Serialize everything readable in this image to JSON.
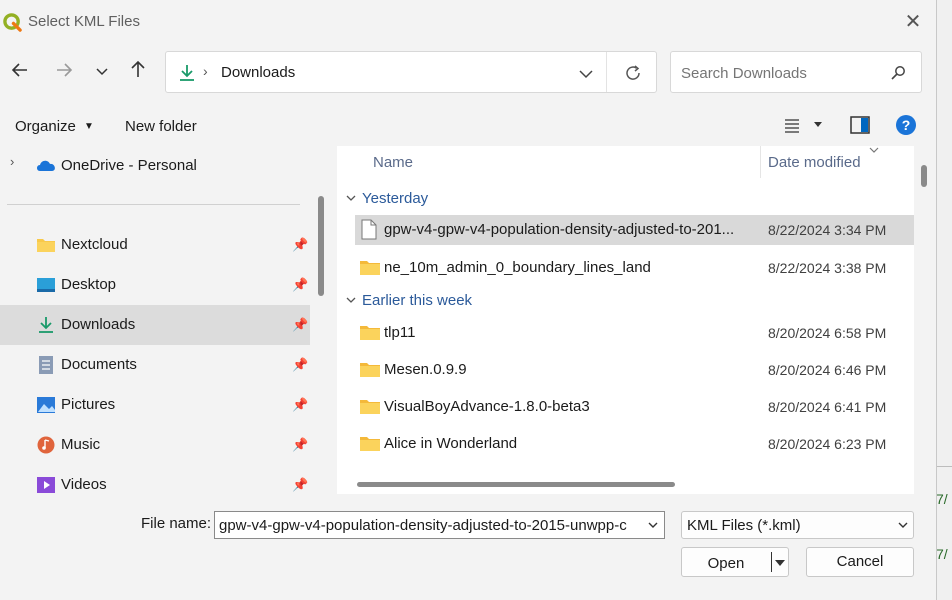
{
  "window": {
    "title": "Select KML Files",
    "close_icon": "close-icon"
  },
  "nav_buttons": {
    "back": "back-icon",
    "forward": "forward-icon",
    "recent": "chevron-down-icon",
    "up": "up-arrow-icon"
  },
  "address": {
    "location": "Downloads",
    "icon": "downloads-icon"
  },
  "search": {
    "placeholder": "Search Downloads"
  },
  "toolbar": {
    "organize_label": "Organize",
    "new_folder_label": "New folder"
  },
  "nav_pane": {
    "onedrive": "OneDrive - Personal",
    "items": [
      {
        "label": "Nextcloud"
      },
      {
        "label": "Desktop"
      },
      {
        "label": "Downloads",
        "selected": true
      },
      {
        "label": "Documents"
      },
      {
        "label": "Pictures"
      },
      {
        "label": "Music"
      },
      {
        "label": "Videos"
      }
    ]
  },
  "file_list": {
    "columns": {
      "name": "Name",
      "date": "Date modified"
    },
    "groups": [
      {
        "label": "Yesterday"
      },
      {
        "label": "Earlier this week"
      }
    ],
    "rows": [
      {
        "name": "gpw-v4-gpw-v4-population-density-adjusted-to-201...",
        "date": "8/22/2024 3:34 PM",
        "type": "file"
      },
      {
        "name": "ne_10m_admin_0_boundary_lines_land",
        "date": "8/22/2024 3:38 PM",
        "type": "folder"
      },
      {
        "name": "tlp11",
        "date": "8/20/2024 6:58 PM",
        "type": "folder"
      },
      {
        "name": "Mesen.0.9.9",
        "date": "8/20/2024 6:46 PM",
        "type": "folder"
      },
      {
        "name": "VisualBoyAdvance-1.8.0-beta3",
        "date": "8/20/2024 6:41 PM",
        "type": "folder"
      },
      {
        "name": "Alice in Wonderland",
        "date": "8/20/2024 6:23 PM",
        "type": "folder"
      }
    ]
  },
  "bottom": {
    "file_name_label": "File name:",
    "file_name_value": "gpw-v4-gpw-v4-population-density-adjusted-to-2015-unwpp-c",
    "filter": "KML Files (*.kml)",
    "open_label": "Open",
    "cancel_label": "Cancel"
  },
  "colors": {
    "accent": "#0067c0",
    "folder": "#f8c94a",
    "selected_row": "#d9d9d9"
  }
}
